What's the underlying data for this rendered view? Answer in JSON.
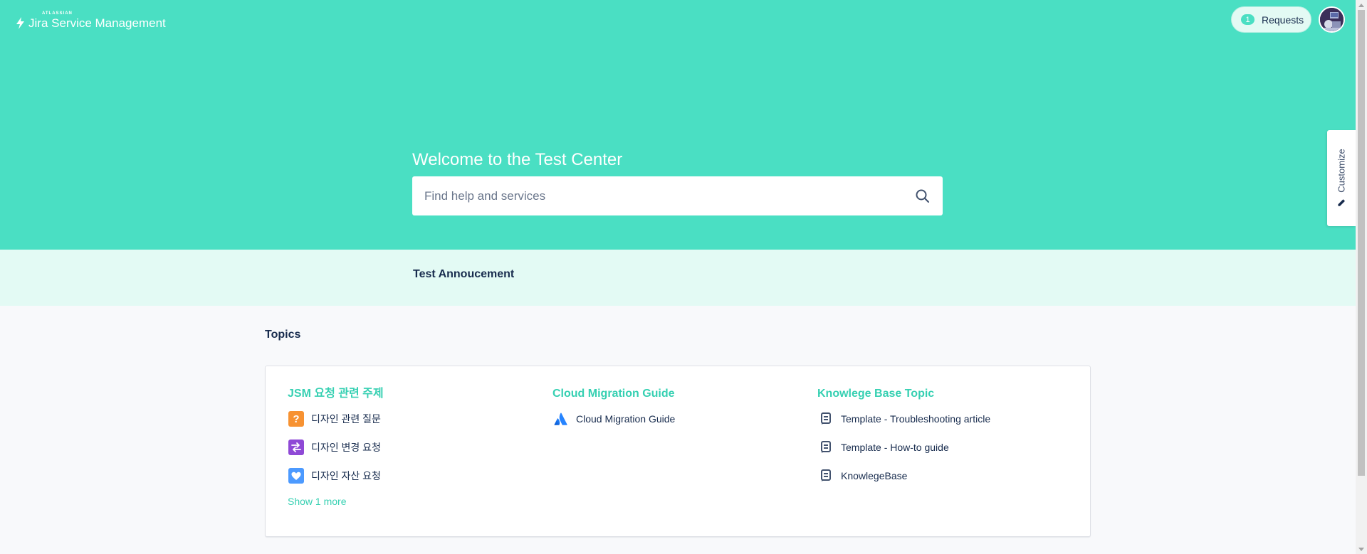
{
  "header": {
    "logo_small": "ATLASSIAN",
    "logo_text": "Jira Service Management",
    "requests_count": "1",
    "requests_label": "Requests"
  },
  "hero": {
    "welcome": "Welcome to the Test Center",
    "search_placeholder": "Find help and services"
  },
  "customize_label": "Customize",
  "announcement": {
    "title": "Test Annoucement"
  },
  "topics": {
    "title": "Topics",
    "columns": [
      {
        "heading": "JSM 요청 관련 주제",
        "items": [
          {
            "label": "디자인 관련 질문",
            "icon": "question-icon"
          },
          {
            "label": "디자인 변경 요청",
            "icon": "swap-icon"
          },
          {
            "label": "디자인 자산 요청",
            "icon": "heart-icon"
          }
        ],
        "show_more": "Show 1 more"
      },
      {
        "heading": "Cloud Migration Guide",
        "items": [
          {
            "label": "Cloud Migration Guide",
            "icon": "atlassian-icon"
          }
        ]
      },
      {
        "heading": "Knowlege Base Topic",
        "items": [
          {
            "label": "Template - Troubleshooting article",
            "icon": "article-icon"
          },
          {
            "label": "Template - How-to guide",
            "icon": "article-icon"
          },
          {
            "label": "KnowlegeBase",
            "icon": "article-icon"
          }
        ]
      }
    ]
  },
  "colors": {
    "brand": "#4adfc3",
    "link": "#36d0b2",
    "announcement_bg": "#e3faf4"
  }
}
